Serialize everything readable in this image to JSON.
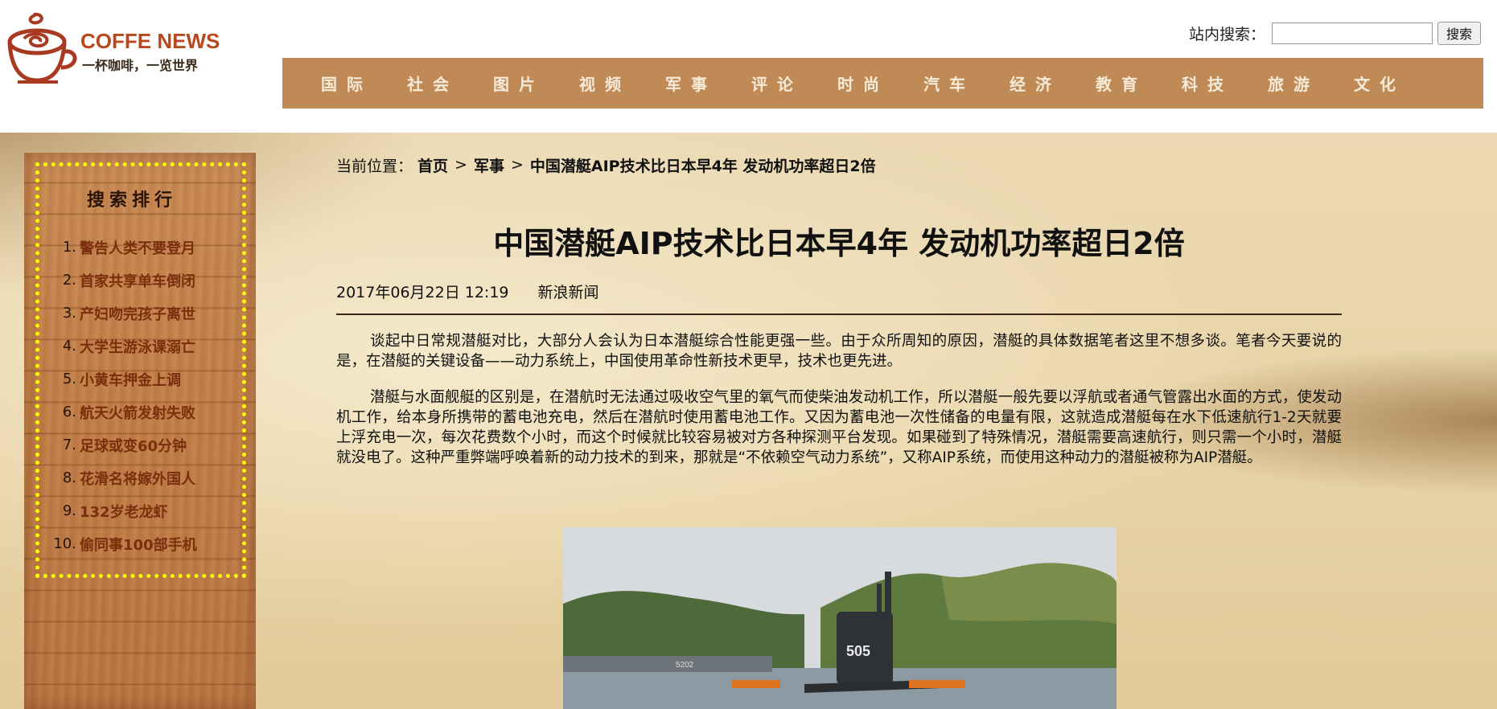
{
  "header": {
    "logo_title": "COFFE NEWS",
    "logo_slogan": "一杯咖啡，一览世界",
    "search_label": "站内搜索：",
    "search_value": "",
    "search_button": "搜索"
  },
  "nav": {
    "items": [
      "国际",
      "社会",
      "图片",
      "视频",
      "军事",
      "评论",
      "时尚",
      "汽车",
      "经济",
      "教育",
      "科技",
      "旅游",
      "文化"
    ]
  },
  "sidebar": {
    "title": "搜索排行",
    "items": [
      {
        "num": "1.",
        "text": "警告人类不要登月"
      },
      {
        "num": "2.",
        "text": "首家共享单车倒闭"
      },
      {
        "num": "3.",
        "text": "产妇吻完孩子离世"
      },
      {
        "num": "4.",
        "text": "大学生游泳课溺亡"
      },
      {
        "num": "5.",
        "text": "小黄车押金上调"
      },
      {
        "num": "6.",
        "text": "航天火箭发射失败"
      },
      {
        "num": "7.",
        "text": "足球或变60分钟"
      },
      {
        "num": "8.",
        "text": "花滑名将嫁外国人"
      },
      {
        "num": "9.",
        "text": "132岁老龙虾"
      },
      {
        "num": "10.",
        "text": "偷同事100部手机"
      }
    ]
  },
  "article": {
    "breadcrumb_label": "当前位置：",
    "crumb_home": "首页",
    "crumb_section": "军事",
    "crumb_current": "中国潜艇AIP技术比日本早4年 发动机功率超日2倍",
    "sep": ">",
    "title": "中国潜艇AIP技术比日本早4年 发动机功率超日2倍",
    "date": "2017年06月22日 12:19",
    "source": "新浪新闻",
    "paragraphs": [
      "谈起中日常规潜艇对比，大部分人会认为日本潜艇综合性能更强一些。由于众所周知的原因，潜艇的具体数据笔者这里不想多谈。笔者今天要说的是，在潜艇的关键设备——动力系统上，中国使用革命性新技术更早，技术也更先进。",
      "潜艇与水面舰艇的区别是，在潜航时无法通过吸收空气里的氧气而使柴油发动机工作，所以潜艇一般先要以浮航或者通气管露出水面的方式，使发动机工作，给本身所携带的蓄电池充电，然后在潜航时使用蓄电池工作。又因为蓄电池一次性储备的电量有限，这就造成潜艇每在水下低速航行1-2天就要上浮充电一次，每次花费数个小时，而这个时候就比较容易被对方各种探测平台发现。如果碰到了特殊情况，潜艇需要高速航行，则只需一个小时，潜艇就没电了。这种严重弊端呼唤着新的动力技术的到来，那就是“不依赖空气动力系统”，又称AIP系统，而使用这种动力的潜艇被称为AIP潜艇。"
    ],
    "photo_hull_number": "505",
    "photo_pier_number": "5202"
  }
}
